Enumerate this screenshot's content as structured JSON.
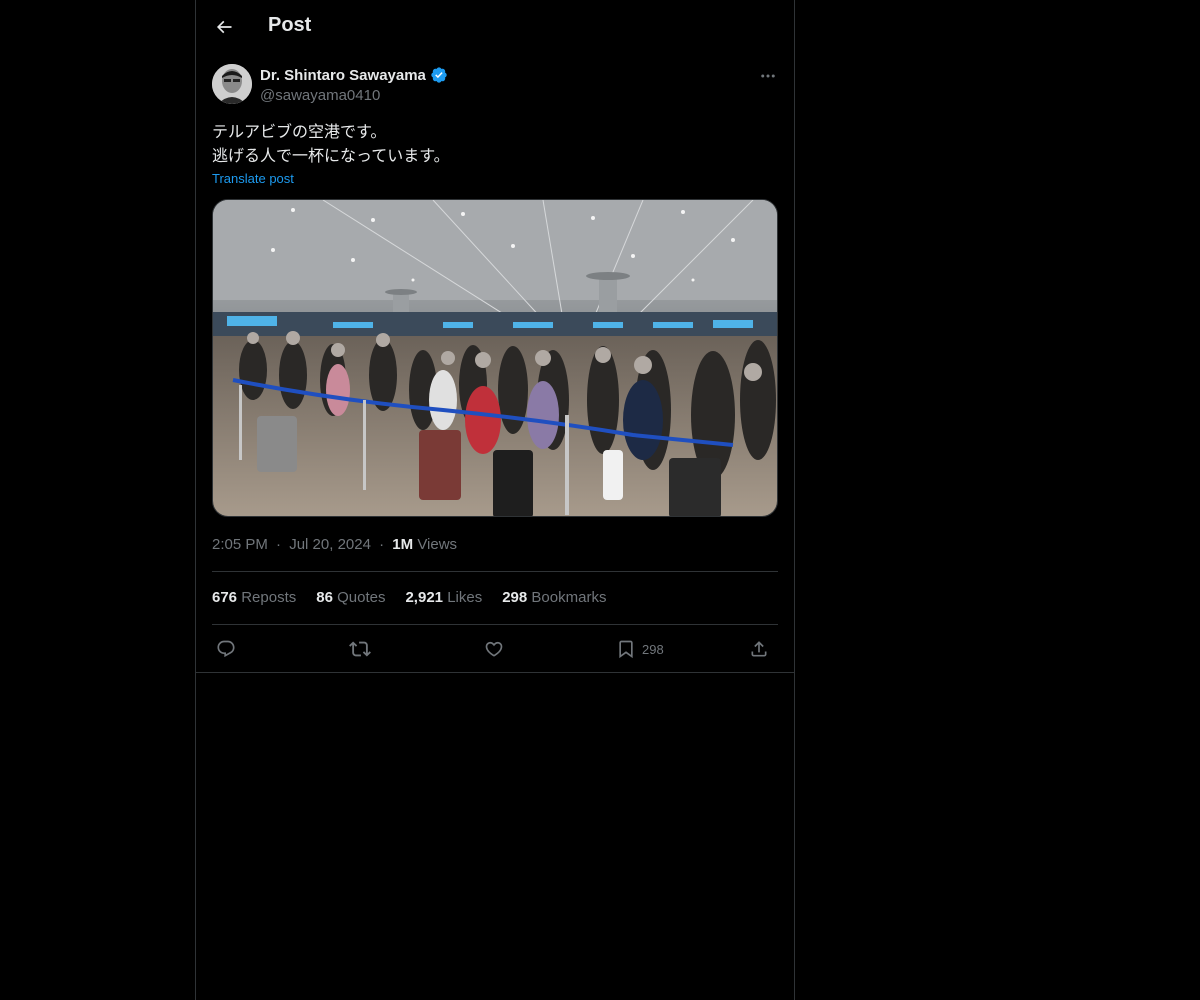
{
  "header": {
    "title": "Post"
  },
  "post": {
    "author_name": "Dr. Shintaro Sawayama",
    "handle": "@sawayama0410",
    "text_lines": [
      "テルアビブの空港です。",
      "逃げる人で一杯になっています。"
    ],
    "translate_label": "Translate post",
    "time": "2:05 PM",
    "date": "Jul 20, 2024",
    "views_count": "1M",
    "views_label": "Views",
    "separator": "·"
  },
  "stats": {
    "reposts_count": "676",
    "reposts_label": "Reposts",
    "quotes_count": "86",
    "quotes_label": "Quotes",
    "likes_count": "2,921",
    "likes_label": "Likes",
    "bookmarks_count": "298",
    "bookmarks_label": "Bookmarks"
  },
  "actions": {
    "bookmark_count": "298"
  },
  "icons": {
    "back": "arrow-left-icon",
    "verified": "verified-badge-icon",
    "more": "more-horizontal-icon",
    "reply": "reply-icon",
    "repost": "repost-icon",
    "like": "heart-icon",
    "bookmark": "bookmark-icon",
    "share": "share-icon"
  },
  "colors": {
    "background": "#000000",
    "text_primary": "#e7e9ea",
    "text_secondary": "#71767b",
    "accent": "#1d9bf0",
    "border": "#2f3336"
  }
}
